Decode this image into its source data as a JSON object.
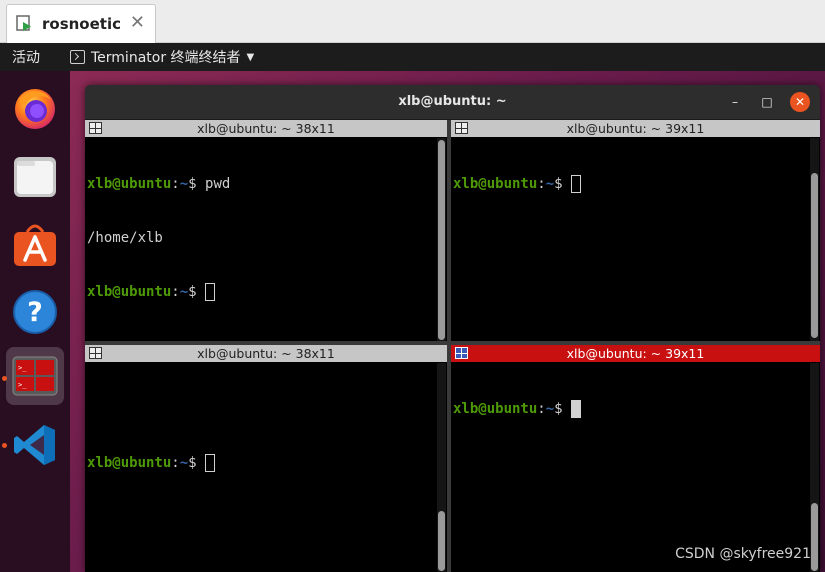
{
  "vm_tab": {
    "title": "rosnoetic",
    "close": "✕"
  },
  "topbar": {
    "activities": "活动",
    "app_menu": "Terminator 终端终结者",
    "arrow": "▼"
  },
  "window": {
    "title": "xlb@ubuntu: ~",
    "minimize": "–",
    "maximize": "□",
    "close": "✕"
  },
  "panes": [
    {
      "header": "xlb@ubuntu: ~ 38x11",
      "lines": [
        {
          "user": "xlb@ubuntu",
          "sep": ":",
          "path": "~",
          "prompt": "$ ",
          "cmd": "pwd"
        },
        {
          "output": "/home/xlb"
        },
        {
          "user": "xlb@ubuntu",
          "sep": ":",
          "path": "~",
          "prompt": "$ ",
          "cmd": ""
        }
      ]
    },
    {
      "header": "xlb@ubuntu: ~ 39x11",
      "lines": [
        {
          "user": "xlb@ubuntu",
          "sep": ":",
          "path": "~",
          "prompt": "$ ",
          "cmd": ""
        }
      ]
    },
    {
      "header": "xlb@ubuntu: ~ 38x11",
      "lines": [
        {
          "user": "xlb@ubuntu",
          "sep": ":",
          "path": "~",
          "prompt": "$ ",
          "cmd": ""
        }
      ]
    },
    {
      "header": "xlb@ubuntu: ~ 39x11",
      "lines": [
        {
          "user": "xlb@ubuntu",
          "sep": ":",
          "path": "~",
          "prompt": "$ ",
          "cmd": ""
        }
      ]
    }
  ],
  "dock": [
    {
      "name": "firefox-icon"
    },
    {
      "name": "files-icon"
    },
    {
      "name": "app-store-icon"
    },
    {
      "name": "help-icon"
    },
    {
      "name": "terminator-icon"
    },
    {
      "name": "vscode-icon"
    }
  ],
  "watermark": "CSDN @skyfree921",
  "colors": {
    "prompt_user": "#4e9a06",
    "prompt_path": "#3465a4",
    "active_header": "#c91010",
    "ubuntu_orange": "#e95420"
  }
}
